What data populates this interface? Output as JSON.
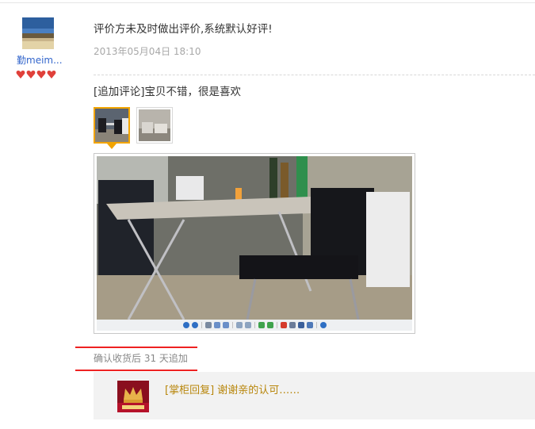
{
  "reviewer": {
    "username": "勤meim...",
    "avatar_icon": "beach-landscape-avatar",
    "rank_icon": "red-heart-rating-icons",
    "rank_hearts": 4
  },
  "review": {
    "text": "评价方未及时做出评价,系统默认好评!",
    "date": "2013年05月04日 18:10"
  },
  "append_review": {
    "text": "[追加评论]宝贝不错，很是喜欢",
    "photos": [
      {
        "name": "dining-table-photo",
        "selected": true
      },
      {
        "name": "sofa-bed-photo",
        "selected": false
      }
    ],
    "note": "确认收货后 31 天追加"
  },
  "viewer": {
    "toolbar_icons": [
      "prev-icon",
      "next-icon",
      "fit-icon",
      "rotate-left-icon",
      "rotate-right-icon",
      "zoom-in-icon",
      "zoom-out-icon",
      "chart-icon",
      "flip-icon",
      "close-icon",
      "save-icon",
      "print-icon",
      "email-icon",
      "info-icon"
    ]
  },
  "seller_reply": {
    "text": "[掌柜回复] 谢谢亲的认可……",
    "avatar_icon": "shop-crown-logo"
  },
  "colors": {
    "accent_orange": "#f2a400",
    "link_blue": "#3366cc",
    "reply_gold": "#b8860b",
    "marker_red": "#ee2222"
  }
}
